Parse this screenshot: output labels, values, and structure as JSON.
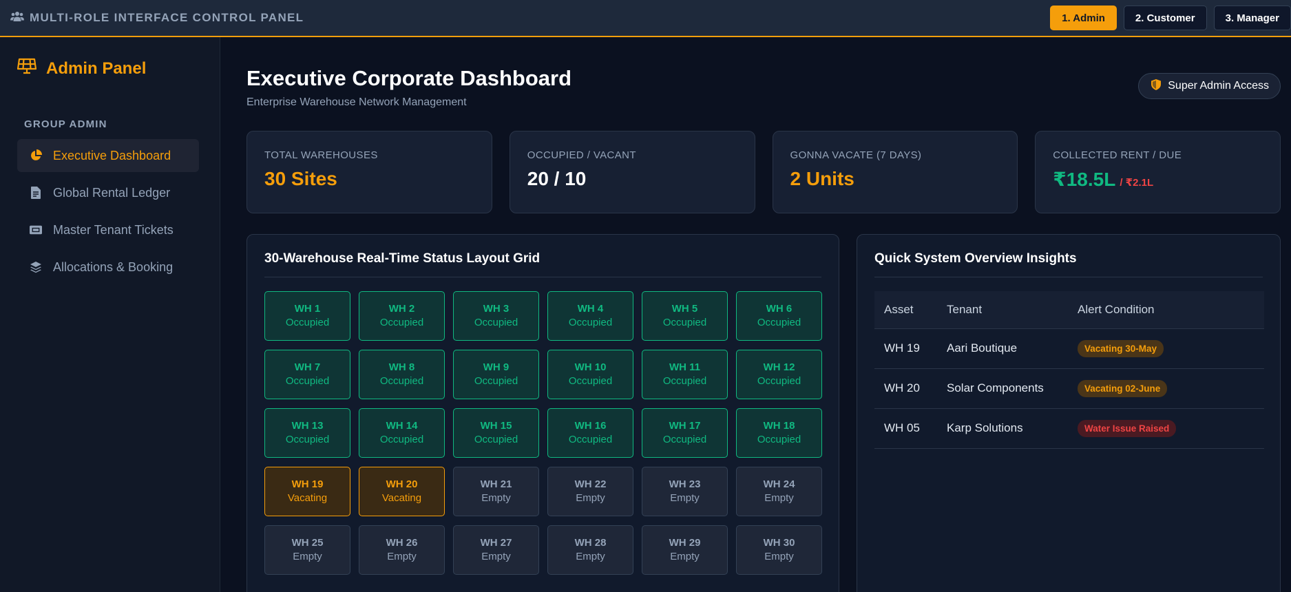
{
  "topbar": {
    "title": "MULTI-ROLE INTERFACE CONTROL PANEL",
    "icon": "users-icon",
    "roles": [
      {
        "label": "1. Admin",
        "active": true
      },
      {
        "label": "2. Customer",
        "active": false
      },
      {
        "label": "3. Manager",
        "active": false
      }
    ]
  },
  "sidebar": {
    "title": "Admin Panel",
    "icon": "solar-panel-icon",
    "group": "GROUP ADMIN",
    "items": [
      {
        "label": "Executive Dashboard",
        "icon": "pie-chart-icon",
        "active": true
      },
      {
        "label": "Global Rental Ledger",
        "icon": "invoice-icon",
        "active": false
      },
      {
        "label": "Master Tenant Tickets",
        "icon": "ticket-icon",
        "active": false
      },
      {
        "label": "Allocations & Booking",
        "icon": "layers-icon",
        "active": false
      }
    ]
  },
  "header": {
    "title": "Executive Corporate Dashboard",
    "subtitle": "Enterprise Warehouse Network Management",
    "access_badge": "Super Admin Access"
  },
  "stats": [
    {
      "label": "TOTAL WAREHOUSES",
      "value": "30 Sites",
      "color": "#f59e0b"
    },
    {
      "label": "OCCUPIED / VACANT",
      "value": "20 / 10",
      "color": "#ffffff"
    },
    {
      "label": "GONNA VACATE (7 DAYS)",
      "value": "2 Units",
      "color": "#f59e0b"
    },
    {
      "label": "COLLECTED RENT / DUE",
      "value": "₹18.5L",
      "sub": "/ ₹2.1L",
      "color": "#10b981",
      "sub_color": "#ef4444"
    }
  ],
  "grid": {
    "title": "30-Warehouse Real-Time Status Layout Grid",
    "warehouses": [
      {
        "name": "WH 1",
        "status": "Occupied"
      },
      {
        "name": "WH 2",
        "status": "Occupied"
      },
      {
        "name": "WH 3",
        "status": "Occupied"
      },
      {
        "name": "WH 4",
        "status": "Occupied"
      },
      {
        "name": "WH 5",
        "status": "Occupied"
      },
      {
        "name": "WH 6",
        "status": "Occupied"
      },
      {
        "name": "WH 7",
        "status": "Occupied"
      },
      {
        "name": "WH 8",
        "status": "Occupied"
      },
      {
        "name": "WH 9",
        "status": "Occupied"
      },
      {
        "name": "WH 10",
        "status": "Occupied"
      },
      {
        "name": "WH 11",
        "status": "Occupied"
      },
      {
        "name": "WH 12",
        "status": "Occupied"
      },
      {
        "name": "WH 13",
        "status": "Occupied"
      },
      {
        "name": "WH 14",
        "status": "Occupied"
      },
      {
        "name": "WH 15",
        "status": "Occupied"
      },
      {
        "name": "WH 16",
        "status": "Occupied"
      },
      {
        "name": "WH 17",
        "status": "Occupied"
      },
      {
        "name": "WH 18",
        "status": "Occupied"
      },
      {
        "name": "WH 19",
        "status": "Vacating"
      },
      {
        "name": "WH 20",
        "status": "Vacating"
      },
      {
        "name": "WH 21",
        "status": "Empty"
      },
      {
        "name": "WH 22",
        "status": "Empty"
      },
      {
        "name": "WH 23",
        "status": "Empty"
      },
      {
        "name": "WH 24",
        "status": "Empty"
      },
      {
        "name": "WH 25",
        "status": "Empty"
      },
      {
        "name": "WH 26",
        "status": "Empty"
      },
      {
        "name": "WH 27",
        "status": "Empty"
      },
      {
        "name": "WH 28",
        "status": "Empty"
      },
      {
        "name": "WH 29",
        "status": "Empty"
      },
      {
        "name": "WH 30",
        "status": "Empty"
      }
    ]
  },
  "insights": {
    "title": "Quick System Overview Insights",
    "columns": [
      "Asset",
      "Tenant",
      "Alert Condition"
    ],
    "rows": [
      {
        "asset": "WH 19",
        "tenant": "Aari Boutique",
        "alert": "Vacating 30-May",
        "level": "warn"
      },
      {
        "asset": "WH 20",
        "tenant": "Solar Components",
        "alert": "Vacating 02-June",
        "level": "warn"
      },
      {
        "asset": "WH 05",
        "tenant": "Karp Solutions",
        "alert": "Water Issue Raised",
        "level": "danger"
      }
    ]
  }
}
